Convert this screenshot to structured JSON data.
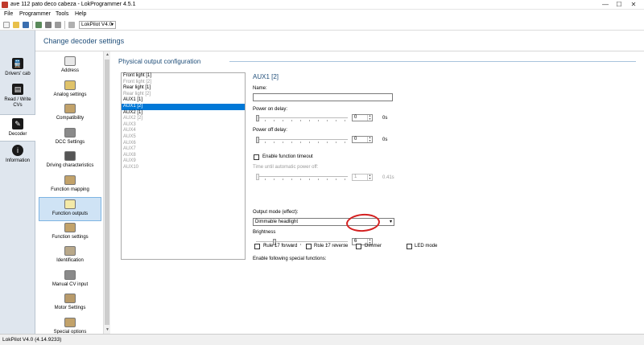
{
  "window": {
    "title": "ave 112 pato deco cabeza - LokProgrammer 4.5.1",
    "minimize_glyph": "—",
    "maximize_glyph": "☐",
    "close_glyph": "✕"
  },
  "menu": {
    "items": [
      "File",
      "Programmer",
      "Tools",
      "Help"
    ]
  },
  "toolbar": {
    "device_select_value": "LokPilot V4.0",
    "icons": [
      "new-file-icon",
      "open-folder-icon",
      "save-icon",
      "upload-icon",
      "download-icon",
      "settings-icon",
      "help-icon"
    ]
  },
  "leftnav": {
    "items": [
      {
        "label": "Drivers' cab",
        "icon": "drivers-cab-icon",
        "glyph": "🚆"
      },
      {
        "label": "Read / Write CVs",
        "icon": "read-write-cvs-icon",
        "glyph": "▤"
      },
      {
        "label": "Decoder",
        "icon": "decoder-icon",
        "glyph": "✎"
      },
      {
        "label": "Information",
        "icon": "information-icon",
        "glyph": "i"
      }
    ],
    "active_index": 2
  },
  "header": {
    "title": "Change decoder settings"
  },
  "subnav": {
    "items": [
      {
        "label": "Address",
        "icon": "envelope-icon",
        "color": "#e8e8e8"
      },
      {
        "label": "Analog settings",
        "icon": "analog-icon",
        "color": "#e0c36a"
      },
      {
        "label": "Compatibility",
        "icon": "compatibility-icon",
        "color": "#c2a26a"
      },
      {
        "label": "DCC Settings",
        "icon": "dcc-icon",
        "color": "#8a8a8a"
      },
      {
        "label": "Driving characteristics",
        "icon": "sliders-icon",
        "color": "#555555"
      },
      {
        "label": "Function mapping",
        "icon": "function-mapping-icon",
        "color": "#c2a26a"
      },
      {
        "label": "Function outputs",
        "icon": "lightbulb-icon",
        "color": "#f3e9a8"
      },
      {
        "label": "Function settings",
        "icon": "function-settings-icon",
        "color": "#c2a26a"
      },
      {
        "label": "Identification",
        "icon": "id-card-icon",
        "color": "#b8a88a"
      },
      {
        "label": "Manual CV input",
        "icon": "pen-icon",
        "color": "#8a8a8a"
      },
      {
        "label": "Motor Settings",
        "icon": "motor-icon",
        "color": "#b89a6a"
      },
      {
        "label": "Special options",
        "icon": "special-options-icon",
        "color": "#c2a26a"
      }
    ],
    "active_index": 6
  },
  "main": {
    "section_title": "Physical output configuration",
    "outputs": [
      {
        "label": "Front light [1]",
        "enabled": true
      },
      {
        "label": "Front light [2]",
        "enabled": false
      },
      {
        "label": "Rear light [1]",
        "enabled": true
      },
      {
        "label": "Rear light [2]",
        "enabled": false
      },
      {
        "label": "AUX1 [1]",
        "enabled": true
      },
      {
        "label": "AUX1 [2]",
        "enabled": true
      },
      {
        "label": "AUX2 [1]",
        "enabled": true
      },
      {
        "label": "AUX2 [2]",
        "enabled": false
      },
      {
        "label": "AUX3",
        "enabled": false
      },
      {
        "label": "AUX4",
        "enabled": false
      },
      {
        "label": "AUX5",
        "enabled": false
      },
      {
        "label": "AUX6",
        "enabled": false
      },
      {
        "label": "AUX7",
        "enabled": false
      },
      {
        "label": "AUX8",
        "enabled": false
      },
      {
        "label": "AUX9",
        "enabled": false
      },
      {
        "label": "AUX10",
        "enabled": false
      }
    ],
    "selected_index": 5,
    "detail": {
      "title": "AUX1 [2]",
      "name_label": "Name:",
      "name_value": "",
      "power_on_delay_label": "Power on delay:",
      "power_on_delay_value": "0",
      "power_on_delay_unit": "0s",
      "power_off_delay_label": "Power off delay:",
      "power_off_delay_value": "0",
      "power_off_delay_unit": "0s",
      "enable_timeout_label": "Enable function timeout",
      "time_until_off_label": "Time until automatic power off:",
      "time_until_off_value": "1",
      "time_until_off_unit": "0.41s",
      "output_mode_label": "Output mode (effect):",
      "output_mode_value": "Dimmable headlight",
      "brightness_label": "Brightness",
      "brightness_value": "6",
      "brightness_level": 0.19,
      "special_functions_label": "Enable following special functions:",
      "special_functions": [
        "Rule 17 forward",
        "Rule 17 reverse",
        "Dimmer",
        "LED mode"
      ]
    }
  },
  "statusbar": {
    "text": "LokPilot V4.0 (4.14.9233)"
  },
  "colors": {
    "accent": "#0078d7",
    "heading": "#1f4e79",
    "annotation": "#d42020"
  }
}
